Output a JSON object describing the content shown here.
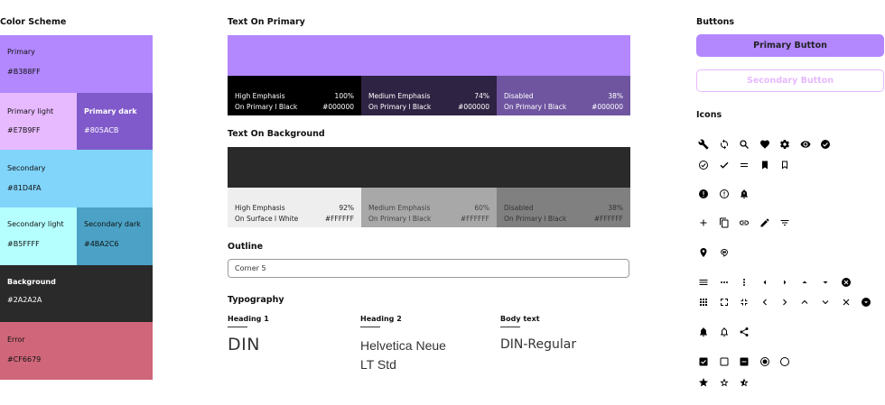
{
  "color_scheme": {
    "title": "Color Scheme",
    "swatches": {
      "primary": {
        "name": "Primary",
        "hex": "#B388FF"
      },
      "primary_light": {
        "name": "Primary light",
        "hex": "#E7B9FF"
      },
      "primary_dark": {
        "name": "Primary dark",
        "hex": "#805ACB"
      },
      "secondary": {
        "name": "Secondary",
        "hex": "#81D4FA"
      },
      "secondary_light": {
        "name": "Secondary light",
        "hex": "#B5FFFF"
      },
      "secondary_dark": {
        "name": "Secondary dark",
        "hex": "#4BA2C6"
      },
      "background": {
        "name": "Background",
        "hex": "#2A2A2A"
      },
      "error": {
        "name": "Error",
        "hex": "#CF6679"
      }
    }
  },
  "text_on_primary": {
    "title": "Text On Primary",
    "cells": [
      {
        "l1": "High Emphasis",
        "l2": "On Primary l Black",
        "r1": "100%",
        "r2": "#000000"
      },
      {
        "l1": "Medium Emphasis",
        "l2": "On Primary l Black",
        "r1": "74%",
        "r2": "#000000"
      },
      {
        "l1": "Disabled",
        "l2": "On Primary l Black",
        "r1": "38%",
        "r2": "#000000"
      }
    ]
  },
  "text_on_background": {
    "title": "Text On Background",
    "cells": [
      {
        "l1": "High Emphasis",
        "l2": "On Surface l White",
        "r1": "92%",
        "r2": "#FFFFFF"
      },
      {
        "l1": "Medium Emphasis",
        "l2": "On Primary l Black",
        "r1": "60%",
        "r2": "#FFFFFF"
      },
      {
        "l1": "Disabled",
        "l2": "On Primary l Black",
        "r1": "38%",
        "r2": "#FFFFFF"
      }
    ]
  },
  "outline": {
    "title": "Outline",
    "field_value": "Corner 5"
  },
  "typography": {
    "title": "Typography",
    "heading1": {
      "label": "Heading 1",
      "sample": "DIN"
    },
    "heading2": {
      "label": "Heading 2",
      "sample_line1": "Helvetica Neue",
      "sample_line2": "LT Std"
    },
    "body": {
      "label": "Body text",
      "sample": "DIN-Regular"
    }
  },
  "buttons": {
    "title": "Buttons",
    "primary_label": "Primary Button",
    "secondary_label": "Secondary Button"
  },
  "icons": {
    "title": "Icons",
    "names": [
      "wrench-icon",
      "sync-icon",
      "search-icon",
      "heart-icon",
      "gear-icon",
      "eye-icon",
      "check-circle-filled-icon",
      "check-circle-outline-icon",
      "check-icon",
      "equals-icon",
      "bookmark-filled-icon",
      "bookmark-outline-icon",
      "error-filled-icon",
      "error-outline-icon",
      "alarm-icon",
      "add-icon",
      "copy-icon",
      "link-icon",
      "edit-icon",
      "filter-icon",
      "location-icon",
      "hangout-icon",
      "menu-icon",
      "more-horiz-icon",
      "more-vert-icon",
      "arrow-left-icon",
      "arrow-right-icon",
      "arrow-up-icon",
      "arrow-down-icon",
      "cancel-filled-icon",
      "apps-icon",
      "fullscreen-icon",
      "fullscreen-exit-icon",
      "chevron-left-icon",
      "chevron-right-icon",
      "chevron-up-icon",
      "chevron-down-icon",
      "close-icon",
      "dropdown-circle-icon",
      "bell-filled-icon",
      "bell-outline-icon",
      "share-icon",
      "checkbox-checked-icon",
      "checkbox-empty-icon",
      "checkbox-indeterminate-icon",
      "radio-checked-icon",
      "radio-empty-icon",
      "star-filled-icon",
      "star-outline-icon",
      "star-half-icon"
    ]
  },
  "colors": {
    "primary": "#B388FF",
    "primary_light": "#E7B9FF",
    "primary_dark": "#805ACB",
    "secondary": "#81D4FA",
    "secondary_light": "#B5FFFF",
    "secondary_dark": "#4BA2C6",
    "background": "#2A2A2A",
    "error": "#CF6679"
  }
}
